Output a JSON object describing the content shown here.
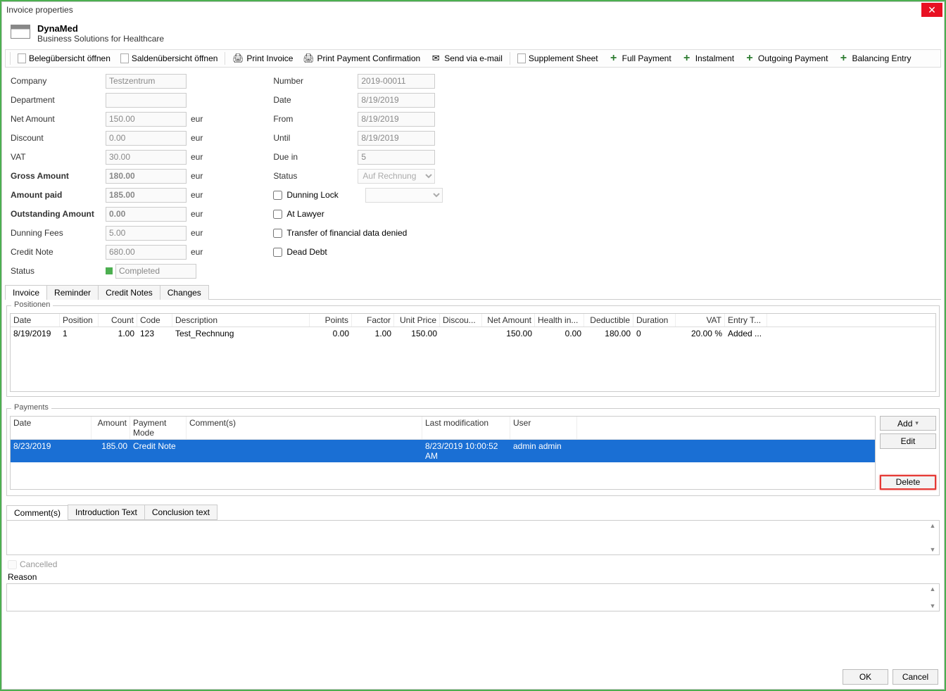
{
  "window": {
    "title": "Invoice properties"
  },
  "brand": {
    "name": "DynaMed",
    "tagline": "Business Solutions for Healthcare"
  },
  "toolbar": {
    "beleg": "Belegübersicht öffnen",
    "salden": "Saldenübersicht öffnen",
    "print_invoice": "Print Invoice",
    "print_payment": "Print Payment Confirmation",
    "email": "Send via e-mail",
    "supplement": "Supplement Sheet",
    "full_payment": "Full Payment",
    "instalment": "Instalment",
    "outgoing": "Outgoing Payment",
    "balancing": "Balancing Entry"
  },
  "labels": {
    "company": "Company",
    "department": "Department",
    "net": "Net Amount",
    "discount": "Discount",
    "vat": "VAT",
    "gross": "Gross Amount",
    "paid": "Amount paid",
    "outstanding": "Outstanding Amount",
    "dunning_fees": "Dunning Fees",
    "credit_note": "Credit Note",
    "status": "Status",
    "number": "Number",
    "date": "Date",
    "from": "From",
    "until": "Until",
    "due": "Due in",
    "status2": "Status",
    "dunning_lock": "Dunning Lock",
    "at_lawyer": "At Lawyer",
    "transfer_denied": "Transfer of financial data denied",
    "dead_debt": "Dead Debt",
    "eur": "eur"
  },
  "values": {
    "company": "Testzentrum",
    "department": "",
    "net": "150.00",
    "discount": "0.00",
    "vat": "30.00",
    "gross": "180.00",
    "paid": "185.00",
    "outstanding": "0.00",
    "dunning_fees": "5.00",
    "credit_note": "680.00",
    "status": "Completed",
    "number": "2019-00011",
    "date": "8/19/2019",
    "from": "8/19/2019",
    "until": "8/19/2019",
    "due": "5",
    "status2": "Auf Rechnung",
    "dl_select": ""
  },
  "tabs": {
    "invoice": "Invoice",
    "reminder": "Reminder",
    "credit_notes": "Credit Notes",
    "changes": "Changes"
  },
  "positionen": {
    "legend": "Positionen",
    "headers": {
      "date": "Date",
      "position": "Position",
      "count": "Count",
      "code": "Code",
      "description": "Description",
      "points": "Points",
      "factor": "Factor",
      "unit_price": "Unit Price",
      "discount": "Discou...",
      "net": "Net Amount",
      "health": "Health in...",
      "deductible": "Deductible",
      "duration": "Duration",
      "vat": "VAT",
      "entry": "Entry T..."
    },
    "row": {
      "date": "8/19/2019",
      "position": "1",
      "count": "1.00",
      "code": "123",
      "description": "Test_Rechnung",
      "points": "0.00",
      "factor": "1.00",
      "unit_price": "150.00",
      "discount": "",
      "net": "150.00",
      "health": "0.00",
      "deductible": "180.00",
      "duration": "0",
      "vat": "20.00 %",
      "entry": "Added ..."
    }
  },
  "payments": {
    "legend": "Payments",
    "headers": {
      "date": "Date",
      "amount": "Amount",
      "mode": "Payment Mode",
      "comments": "Comment(s)",
      "last": "Last modification",
      "user": "User"
    },
    "row": {
      "date": "8/23/2019",
      "amount": "185.00",
      "mode": "Credit Note",
      "comments": "",
      "last": "8/23/2019 10:00:52 AM",
      "user": "admin admin"
    },
    "buttons": {
      "add": "Add",
      "edit": "Edit",
      "delete": "Delete"
    }
  },
  "bottom_tabs": {
    "comments": "Comment(s)",
    "intro": "Introduction Text",
    "conclusion": "Conclusion text"
  },
  "bottom": {
    "cancelled": "Cancelled",
    "reason": "Reason"
  },
  "footer": {
    "ok": "OK",
    "cancel": "Cancel"
  }
}
